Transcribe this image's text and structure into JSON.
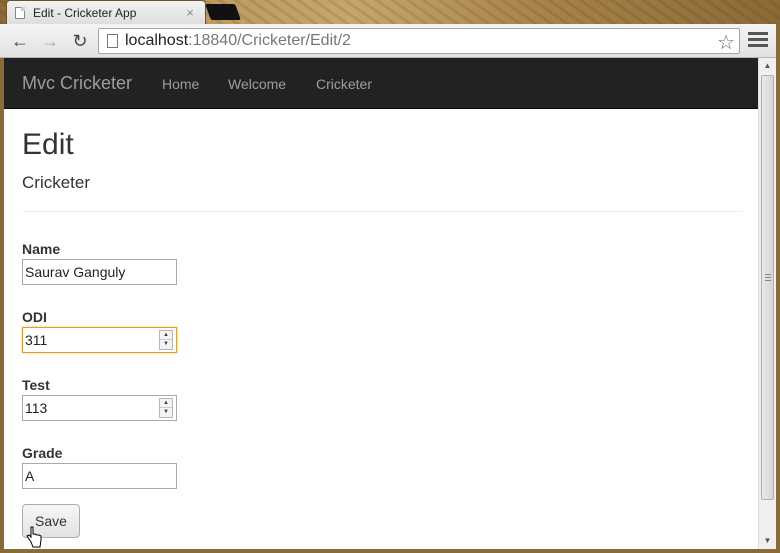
{
  "browser": {
    "tab_title": "Edit - Cricketer App",
    "tab_close": "×",
    "url_host": "localhost",
    "url_path": ":18840/Cricketer/Edit/2",
    "back_icon": "arrow-left-icon",
    "forward_icon": "arrow-right-icon",
    "reload_icon": "reload-icon",
    "star_icon": "star-icon",
    "menu_icon": "menu-icon"
  },
  "navbar": {
    "brand": "Mvc Cricketer",
    "links": [
      "Home",
      "Welcome",
      "Cricketer"
    ],
    "background": "#222222",
    "link_color": "#9d9d9d"
  },
  "page": {
    "title": "Edit",
    "subtitle": "Cricketer"
  },
  "form": {
    "fields": [
      {
        "label": "Name",
        "value": "Saurav Ganguly",
        "type": "text"
      },
      {
        "label": "ODI",
        "value": "311",
        "type": "number",
        "focused": true
      },
      {
        "label": "Test",
        "value": "113",
        "type": "number"
      },
      {
        "label": "Grade",
        "value": "A",
        "type": "text"
      }
    ],
    "save_label": "Save"
  }
}
